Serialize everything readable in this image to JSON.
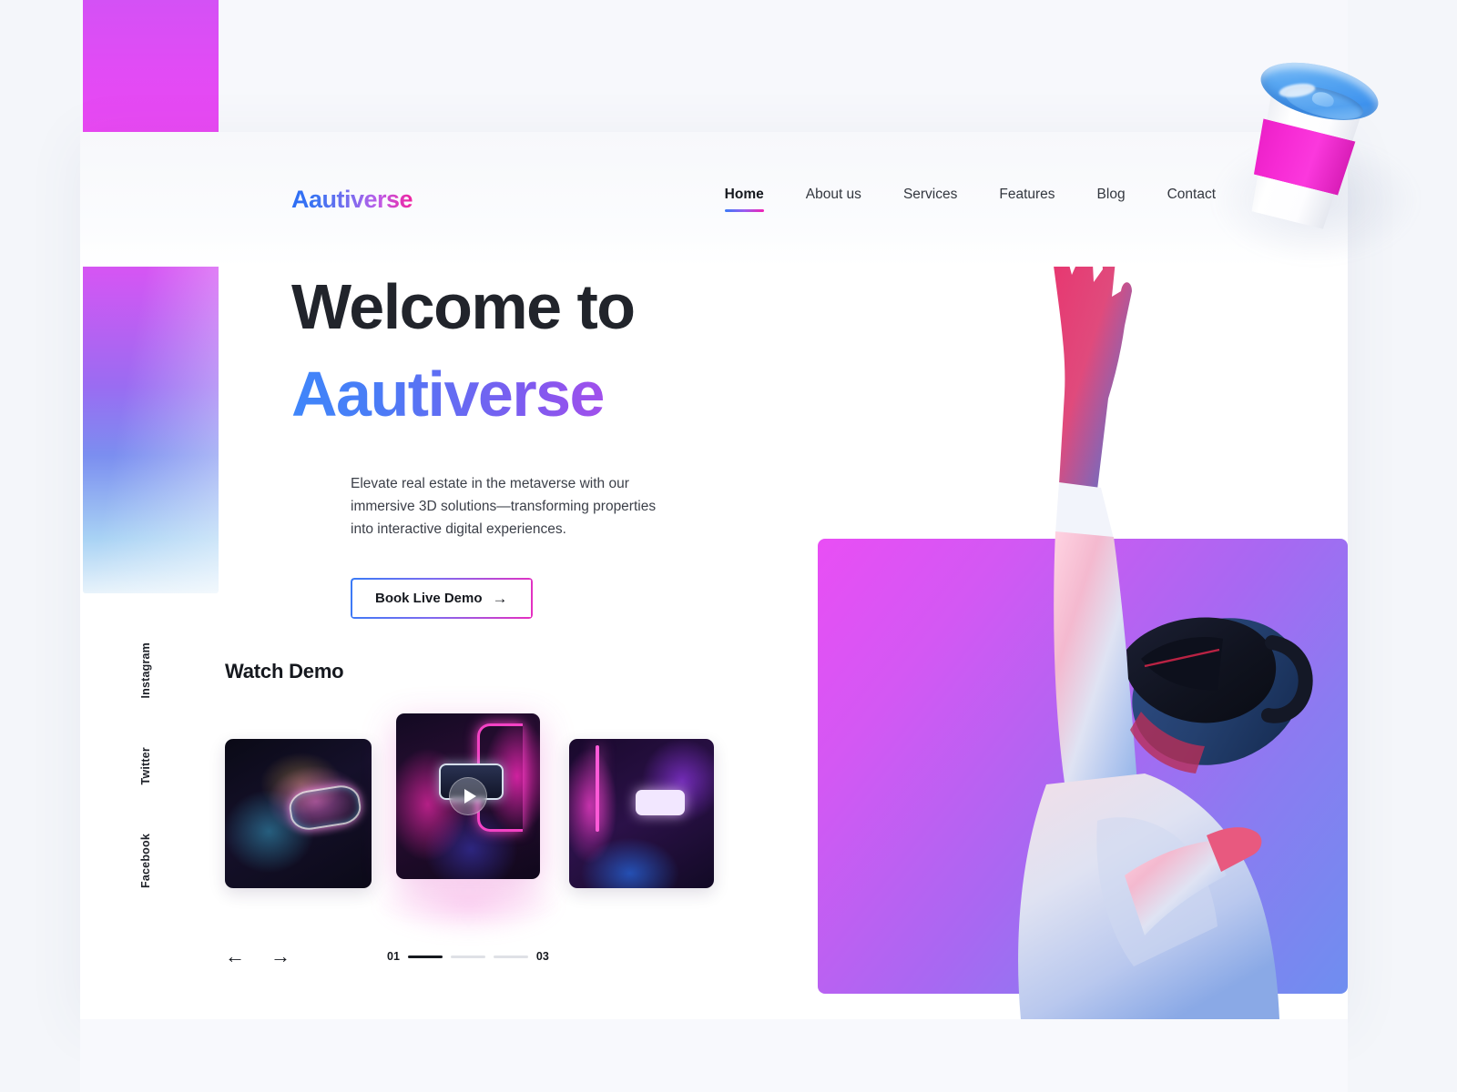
{
  "brand": {
    "logo_text": "Aautiverse",
    "accent_blue": "#2b6df5",
    "accent_purple": "#8259ef",
    "accent_pink": "#f01fa8"
  },
  "nav": {
    "items": [
      {
        "label": "Home",
        "active": true
      },
      {
        "label": "About us",
        "active": false
      },
      {
        "label": "Services",
        "active": false
      },
      {
        "label": "Features",
        "active": false
      },
      {
        "label": "Blog",
        "active": false
      },
      {
        "label": "Contact",
        "active": false
      }
    ]
  },
  "hero": {
    "title_line1": "Welcome to",
    "title_line2": "Aautiverse",
    "subtitle": "Elevate real estate in the metaverse with our immersive 3D solutions—transforming properties into interactive digital experiences.",
    "cta_label": "Book Live Demo",
    "cta_arrow": "→"
  },
  "social": {
    "items": [
      {
        "label": "Instagram"
      },
      {
        "label": "Twitter"
      },
      {
        "label": "Facebook"
      }
    ]
  },
  "watch_demo": {
    "heading": "Watch Demo",
    "thumbnails": [
      {
        "alt": "woman-wearing-glowing-vr-headset-side-profile"
      },
      {
        "alt": "person-adjusting-vr-headset-neon-pink-frame",
        "has_play": true
      },
      {
        "alt": "person-in-vr-headset-holding-controller-blue-light"
      }
    ],
    "play_icon": "play-icon"
  },
  "carousel": {
    "prev_icon": "←",
    "next_icon": "→",
    "current": "01",
    "total": "03",
    "segments": [
      true,
      false,
      false
    ]
  },
  "decor": {
    "coffee_cup": "3d-coffee-cup",
    "hero_media": "vr-user-gradient-panel",
    "left_gradient_bar": "gradient-bar"
  }
}
